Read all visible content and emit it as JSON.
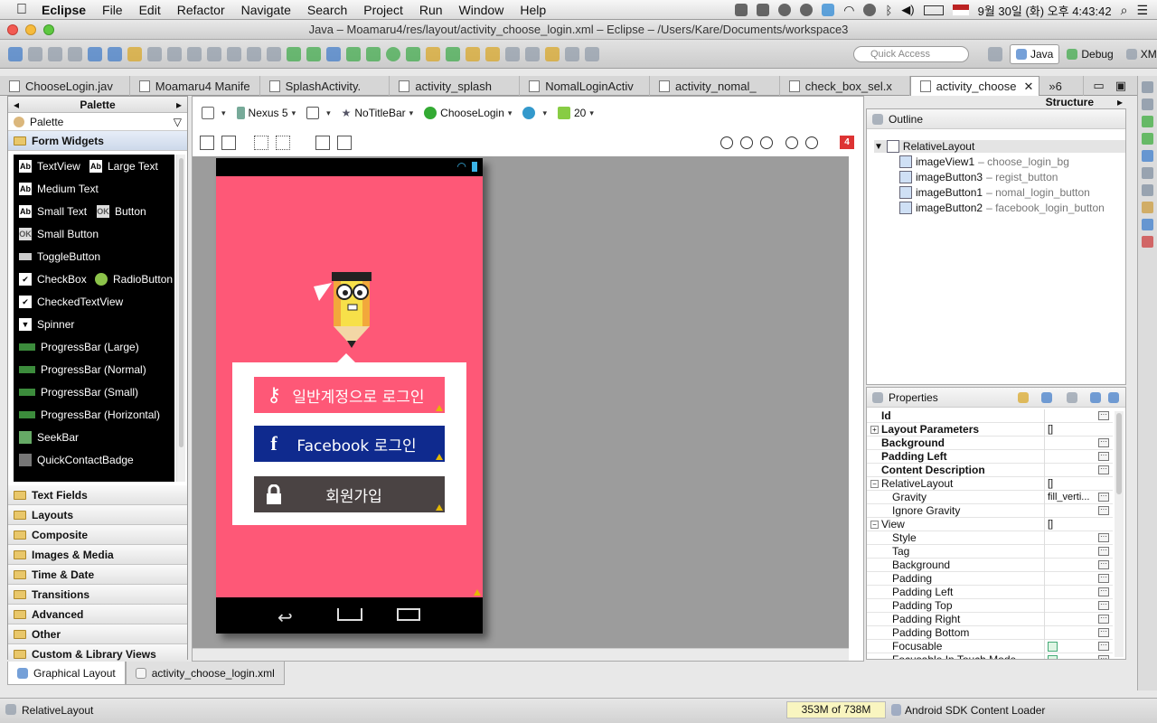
{
  "menubar": {
    "app": "Eclipse",
    "items": [
      "File",
      "Edit",
      "Refactor",
      "Navigate",
      "Search",
      "Project",
      "Run",
      "Window",
      "Help"
    ],
    "clock": "9월 30일 (화) 오후 4:43:42"
  },
  "window": {
    "title": "Java – Moamaru4/res/layout/activity_choose_login.xml – Eclipse – /Users/Kare/Documents/workspace3"
  },
  "toolbar": {
    "quick_access_placeholder": "Quick Access",
    "perspectives": [
      "Java",
      "Debug",
      "XML"
    ]
  },
  "editor_tabs": [
    {
      "label": "ChooseLogin.jav",
      "active": false
    },
    {
      "label": "Moamaru4 Manife",
      "active": false
    },
    {
      "label": "SplashActivity.",
      "active": false
    },
    {
      "label": "activity_splash",
      "active": false
    },
    {
      "label": "NomalLoginActiv",
      "active": false
    },
    {
      "label": "activity_nomal_",
      "active": false
    },
    {
      "label": "check_box_sel.x",
      "active": false
    },
    {
      "label": "activity_choose",
      "active": true
    }
  ],
  "overflow_count": "»6",
  "palette": {
    "title": "Palette",
    "selector": "Palette",
    "open_folder": "Form Widgets",
    "widgets": [
      {
        "label": "TextView",
        "icon": "Ab"
      },
      {
        "label": "Large Text",
        "icon": "Ab"
      },
      {
        "label": "Medium Text",
        "icon": "Ab"
      },
      {
        "label": "Small Text",
        "icon": "Ab"
      },
      {
        "label": "Button",
        "icon": "OK"
      },
      {
        "label": "Small Button",
        "icon": "OK"
      },
      {
        "label": "ToggleButton",
        "icon": "toggle"
      },
      {
        "label": "CheckBox",
        "icon": "check"
      },
      {
        "label": "RadioButton",
        "icon": "radio"
      },
      {
        "label": "CheckedTextView",
        "icon": "check"
      },
      {
        "label": "Spinner",
        "icon": "spinner"
      },
      {
        "label": "ProgressBar (Large)",
        "icon": "progress"
      },
      {
        "label": "ProgressBar (Normal)",
        "icon": "progress"
      },
      {
        "label": "ProgressBar (Small)",
        "icon": "progress"
      },
      {
        "label": "ProgressBar (Horizontal)",
        "icon": "progress"
      },
      {
        "label": "SeekBar",
        "icon": "seek"
      },
      {
        "label": "QuickContactBadge",
        "icon": "badge"
      }
    ],
    "folders": [
      "Text Fields",
      "Layouts",
      "Composite",
      "Images & Media",
      "Time & Date",
      "Transitions",
      "Advanced",
      "Other",
      "Custom & Library Views"
    ]
  },
  "editor": {
    "device": "Nexus 5",
    "theme": "NoTitleBar",
    "activity": "ChooseLogin",
    "api": "20",
    "error_count": "4",
    "buttons": {
      "normal_login": "일반계정으로 로그인",
      "facebook_login": "Facebook 로그인",
      "register": "회원가입"
    },
    "colors": {
      "background": "#fe5877",
      "normal_login": "#fe5877",
      "facebook": "#0f2a8e",
      "register": "#4a4343"
    }
  },
  "structure": {
    "title": "Structure",
    "outline_title": "Outline",
    "root": "RelativeLayout",
    "children": [
      {
        "id": "imageView1",
        "desc": "– choose_login_bg"
      },
      {
        "id": "imageButton3",
        "desc": "– regist_button"
      },
      {
        "id": "imageButton1",
        "desc": "– nomal_login_button"
      },
      {
        "id": "imageButton2",
        "desc": "– facebook_login_button"
      }
    ]
  },
  "properties": {
    "title": "Properties",
    "rows": [
      {
        "name": "Id",
        "bold": true,
        "value": "",
        "dots": true
      },
      {
        "name": "Layout Parameters",
        "bold": true,
        "value": "[]",
        "expand": "+"
      },
      {
        "name": "Background",
        "bold": true,
        "value": "",
        "dots": true
      },
      {
        "name": "Padding Left",
        "bold": true,
        "value": "",
        "dots": true
      },
      {
        "name": "Content Description",
        "bold": true,
        "value": "",
        "dots": true
      },
      {
        "name": "RelativeLayout",
        "bold": false,
        "value": "[]",
        "expand": "−"
      },
      {
        "name": "Gravity",
        "bold": false,
        "indent": true,
        "value": "fill_verti...",
        "dots": true
      },
      {
        "name": "Ignore Gravity",
        "bold": false,
        "indent": true,
        "value": "",
        "dots": true
      },
      {
        "name": "View",
        "bold": false,
        "value": "[]",
        "expand": "−"
      },
      {
        "name": "Style",
        "bold": false,
        "indent": true,
        "value": "",
        "dots": true
      },
      {
        "name": "Tag",
        "bold": false,
        "indent": true,
        "value": "",
        "dots": true
      },
      {
        "name": "Background",
        "bold": false,
        "indent": true,
        "value": "",
        "dots": true
      },
      {
        "name": "Padding",
        "bold": false,
        "indent": true,
        "value": "",
        "dots": true
      },
      {
        "name": "Padding Left",
        "bold": false,
        "indent": true,
        "value": "",
        "dots": true
      },
      {
        "name": "Padding Top",
        "bold": false,
        "indent": true,
        "value": "",
        "dots": true
      },
      {
        "name": "Padding Right",
        "bold": false,
        "indent": true,
        "value": "",
        "dots": true
      },
      {
        "name": "Padding Bottom",
        "bold": false,
        "indent": true,
        "value": "",
        "dots": true
      },
      {
        "name": "Focusable",
        "bold": false,
        "indent": true,
        "value": "",
        "checkbox": true,
        "dots": true
      },
      {
        "name": "Focusable In Touch Mode",
        "bold": false,
        "indent": true,
        "value": "",
        "checkbox": true,
        "dots": true
      }
    ]
  },
  "bottom_tabs": [
    "Graphical Layout",
    "activity_choose_login.xml"
  ],
  "status": {
    "left": "RelativeLayout",
    "memory": "353M of 738M",
    "job": "Android SDK Content Loader"
  }
}
